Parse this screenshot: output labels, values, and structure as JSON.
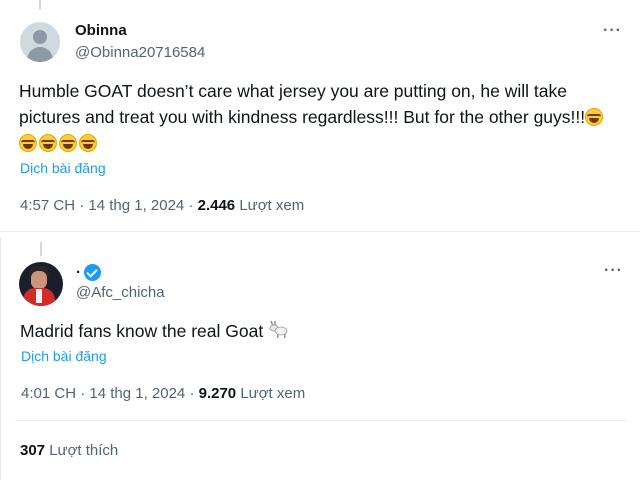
{
  "tweet1": {
    "display_name": "Obinna",
    "handle": "@Obinna20716584",
    "text": "Humble GOAT doesn’t care what jersey you are putting on, he will take pictures and treat you with kindness regardless!!! But for the other guys!!!",
    "emoji_icon": "tears-of-joy-emoji",
    "emoji_count": 5,
    "translate": "Dịch bài đăng",
    "time": "4:57 CH · 14 thg 1, 2024 · ",
    "views": "2.446",
    "views_label": " Lượt xem"
  },
  "tweet2": {
    "display_name": ".",
    "handle": "@Afc_chicha",
    "text": "Madrid fans know the real Goat",
    "emoji_icon": "goat-emoji",
    "translate": "Dịch bài đăng",
    "time": "4:01 CH · 14 thg 1, 2024 · ",
    "views": "9.270",
    "views_label": " Lượt xem",
    "likes_count": "307",
    "likes_label": " Lượt thích"
  },
  "more_icon": "more-horizontal-icon",
  "colors": {
    "link": "#1d9bf0",
    "secondary_text": "#536471",
    "primary_text": "#0f1419",
    "border": "#e6ecf0"
  }
}
